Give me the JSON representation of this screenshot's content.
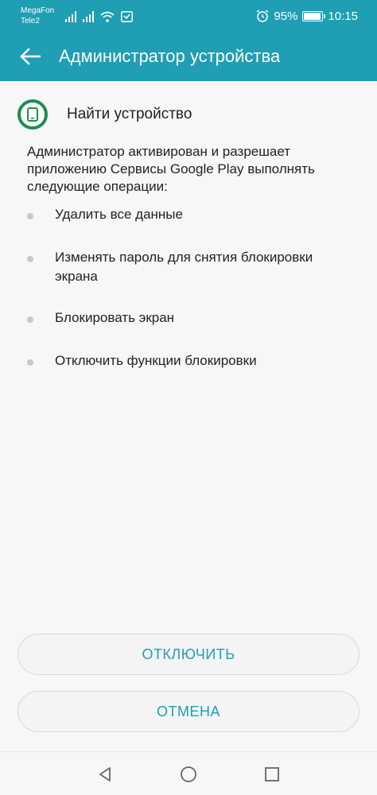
{
  "status_bar": {
    "carrier_1": "MegaFon",
    "carrier_2": "Tele2",
    "battery_percent": "95%",
    "battery_level": 0.95,
    "time": "10:15",
    "icons": [
      "signal-icon",
      "signal-icon",
      "wifi-icon",
      "notification-icon",
      "alarm-icon",
      "battery-icon"
    ]
  },
  "app_bar": {
    "title": "Администратор устройства",
    "back_icon": "back-arrow-icon"
  },
  "device": {
    "name": "Найти устройство",
    "icon": "find-device-icon",
    "icon_color": "#1d8f4e"
  },
  "description": "Администратор активирован и разрешает приложению Сервисы Google Play выполнять следующие операции:",
  "permissions": [
    "Удалить все данные",
    "Изменять пароль для снятия блокировки экрана",
    "Блокировать экран",
    "Отключить функции блокировки"
  ],
  "buttons": {
    "deactivate_label": "ОТКЛЮЧИТЬ",
    "cancel_label": "ОТМЕНА"
  },
  "nav_bar": {
    "icons": [
      "back-triangle-icon",
      "home-circle-icon",
      "recents-square-icon"
    ]
  },
  "colors": {
    "accent": "#1f9eb4",
    "background": "#f7f7f7",
    "button_text": "#1f9eb4"
  }
}
